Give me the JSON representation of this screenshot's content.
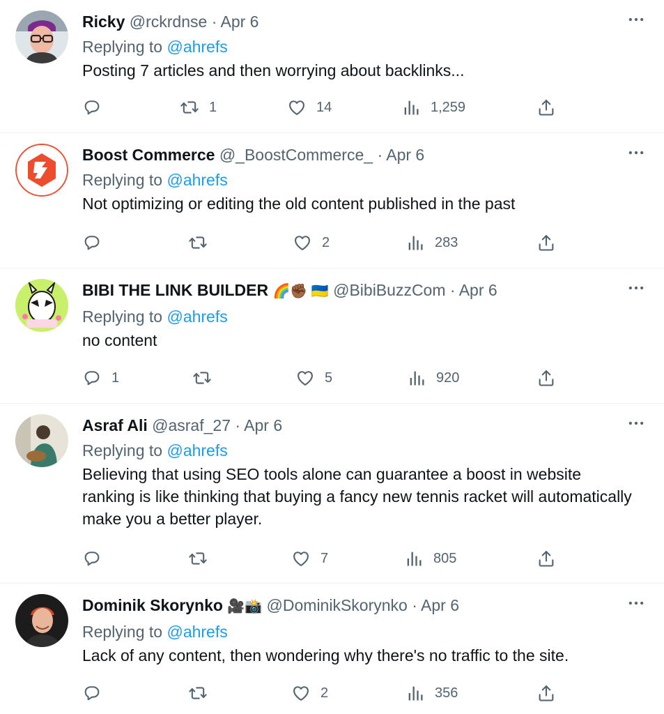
{
  "tweets": [
    {
      "name": "Ricky",
      "handle": "@rckrdnse",
      "sep": "·",
      "date": "Apr 6",
      "replying_prefix": "Replying to",
      "replying_to": "@ahrefs",
      "text": "Posting 7 articles and then worrying about backlinks...",
      "replies": "",
      "retweets": "1",
      "likes": "14",
      "views": "1,259"
    },
    {
      "name": "Boost Commerce",
      "handle": "@_BoostCommerce_",
      "sep": "·",
      "date": "Apr 6",
      "replying_prefix": "Replying to",
      "replying_to": "@ahrefs",
      "text": "Not optimizing or editing the old content published in the past",
      "replies": "",
      "retweets": "",
      "likes": "2",
      "views": "283"
    },
    {
      "name": "BIBI THE LINK BUILDER",
      "name_emojis": "🌈✊🏾 🇺🇦",
      "handle": "@BibiBuzzCom",
      "sep": "·",
      "date": "Apr 6",
      "replying_prefix": "Replying to",
      "replying_to": "@ahrefs",
      "text": "no content",
      "replies": "1",
      "retweets": "",
      "likes": "5",
      "views": "920"
    },
    {
      "name": "Asraf Ali",
      "handle": "@asraf_27",
      "sep": "·",
      "date": "Apr 6",
      "replying_prefix": "Replying to",
      "replying_to": "@ahrefs",
      "text": "Believing that using SEO tools alone can guarantee a boost in website ranking is like thinking that buying a fancy new tennis racket will automatically make you a better player.",
      "replies": "",
      "retweets": "",
      "likes": "7",
      "views": "805"
    },
    {
      "name": "Dominik Skorynko",
      "name_emojis": "🎥📸",
      "handle": "@DominikSkorynko",
      "sep": "·",
      "date": "Apr 6",
      "replying_prefix": "Replying to",
      "replying_to": "@ahrefs",
      "text": "Lack of any content, then wondering why there's no traffic to the site.",
      "replies": "",
      "retweets": "",
      "likes": "2",
      "views": "356"
    }
  ],
  "icons": {
    "more": "more-horizontal-icon",
    "reply": "reply-bubble-icon",
    "retweet": "retweet-icon",
    "like": "heart-icon",
    "views": "views-bar-chart-icon",
    "share": "share-upload-icon"
  },
  "colors": {
    "text_primary": "#0f1419",
    "text_secondary": "#536471",
    "link": "#1d9bf0",
    "divider": "#eff3f4",
    "boost_brand": "#ee4d2d"
  }
}
